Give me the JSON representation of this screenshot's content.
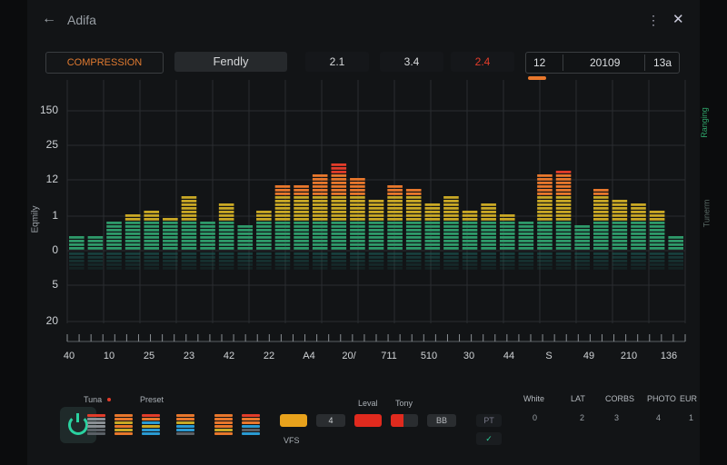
{
  "app": {
    "title": "Adifa"
  },
  "toolbar": {
    "comp_label": "COMPRESSION",
    "friendly_label": "Fendly",
    "val_a": "2.1",
    "val_b": "3.4",
    "val_c": "2.4",
    "group": [
      "12",
      "20109",
      "13a"
    ]
  },
  "chart_data": {
    "type": "bar",
    "y_tick_labels": [
      "150",
      "25",
      "12",
      "1",
      "0",
      "5",
      "20"
    ],
    "ylabel": "Eqmily",
    "x_tick_labels": [
      "40",
      "10",
      "25",
      "23",
      "42",
      "22",
      "A4",
      "20/",
      "711",
      "510",
      "30",
      "44",
      "S",
      "49",
      "210",
      "136"
    ],
    "bar_levels": [
      0.6,
      0.5,
      1.2,
      1.4,
      1.6,
      1.3,
      2.2,
      1.2,
      1.8,
      1.0,
      1.6,
      2.5,
      2.5,
      3.0,
      3.4,
      2.8,
      2.0,
      2.6,
      2.4,
      1.8,
      2.1,
      1.5,
      1.8,
      1.4,
      1.2,
      3.0,
      3.2,
      1.0,
      2.4,
      2.0,
      1.8,
      1.5,
      0.6
    ],
    "colors": {
      "low": "#2e9a6a",
      "mid": "#c9a825",
      "high": "#e8772c",
      "peak": "#e23c2a"
    },
    "grid": true
  },
  "bottom": {
    "label_tun": "Tuna",
    "label_preset": "Preset",
    "label_vfs": "VFS",
    "label_level": "Leval",
    "label_tony": "Tony",
    "btn_4": "4",
    "btn_bb": "BB",
    "btn_pt": "PT",
    "stats": [
      {
        "h": "White",
        "v": "0"
      },
      {
        "h": "LAT",
        "v": "2"
      },
      {
        "h": "CORBS",
        "v": "3"
      },
      {
        "h": "PHOTO",
        "v": "4"
      },
      {
        "h": "EUR",
        "v": "1"
      }
    ]
  },
  "right_edge": {
    "a": "Ranging",
    "b": "Tunerm"
  }
}
